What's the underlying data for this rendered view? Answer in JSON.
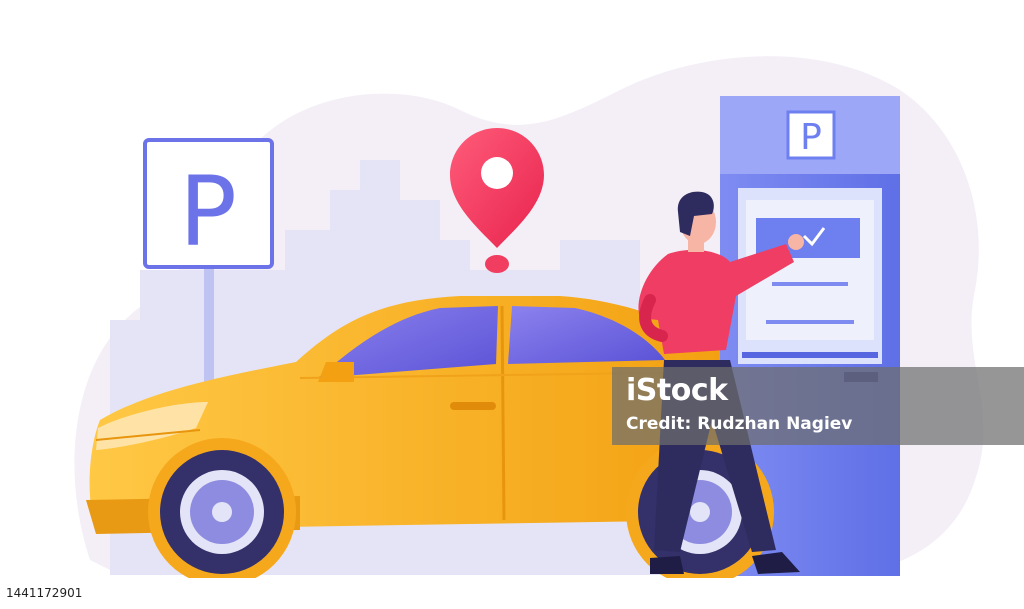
{
  "illustration": {
    "parking_sign": {
      "letter": "P"
    },
    "kiosk": {
      "header_letter": "P"
    },
    "colors": {
      "background_blob": "#F3EEF6",
      "city_silhouette": "#E4E4F5",
      "sign_blue": "#6C73E8",
      "pin_red": "#F03D60",
      "car_yellow": "#FBB62E",
      "car_window": "#6C63E0",
      "kiosk_blue": "#6E7FF0",
      "person_shirt": "#F03D63",
      "person_pants": "#2E2C5E"
    }
  },
  "watermark": {
    "logo": "iStock",
    "credit": "Credit: Rudzhan Nagiev"
  },
  "footer": {
    "image_id": "1441172901"
  }
}
